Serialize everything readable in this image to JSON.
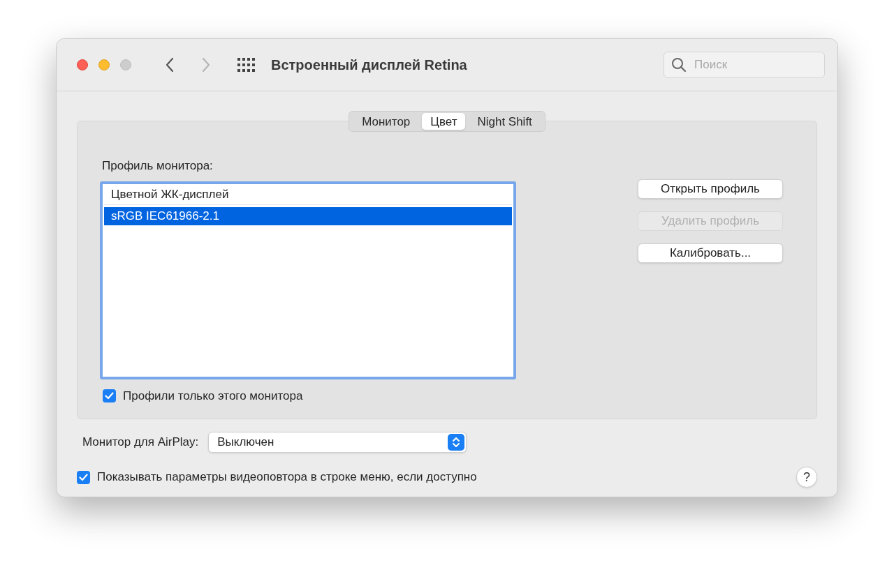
{
  "window": {
    "title": "Встроенный дисплей Retina"
  },
  "navigation": {
    "back_disabled": false,
    "forward_disabled": true
  },
  "search": {
    "placeholder": "Поиск"
  },
  "tabs": [
    {
      "label": "Монитор",
      "selected": false
    },
    {
      "label": "Цвет",
      "selected": true
    },
    {
      "label": "Night Shift",
      "selected": false
    }
  ],
  "profile_label": "Профиль монитора:",
  "profiles": [
    {
      "name": "Цветной ЖК-дисплей",
      "selected": false
    },
    {
      "name": "sRGB IEC61966-2.1",
      "selected": true
    }
  ],
  "only_this_monitor": {
    "label": "Профили только этого монитора",
    "checked": true
  },
  "profile_buttons": [
    {
      "label": "Открыть профиль",
      "disabled": false
    },
    {
      "label": "Удалить профиль",
      "disabled": true
    },
    {
      "label": "Калибровать...",
      "disabled": false
    }
  ],
  "airplay": {
    "label": "Монитор для AirPlay:",
    "value": "Выключен"
  },
  "mirroring_option": {
    "label": "Показывать параметры видеоповтора в строке меню, если доступно",
    "checked": true
  },
  "help_button": "?"
}
